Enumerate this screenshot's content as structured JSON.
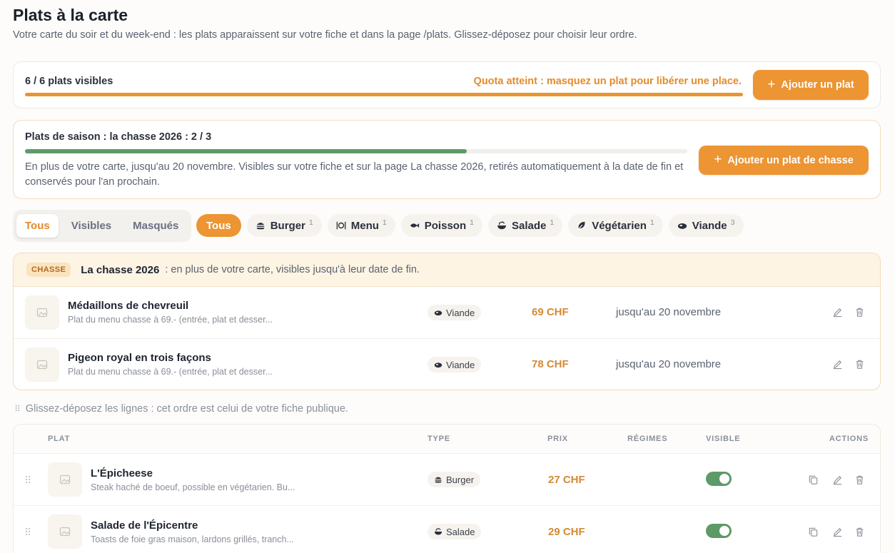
{
  "header": {
    "title": "Plats à la carte",
    "subtitle": "Votre carte du soir et du week-end : les plats apparaissent sur votre fiche et dans la page /plats. Glissez-déposez pour choisir leur ordre."
  },
  "quota": {
    "count_label": "6 / 6 plats visibles",
    "used": 6,
    "max": 6,
    "warning": "Quota atteint : masquez un plat pour libérer une place.",
    "add_button": "Ajouter un plat"
  },
  "season": {
    "title": "Plats de saison : la chasse 2026 : 2 / 3",
    "used": 2,
    "max": 3,
    "description": "En plus de votre carte, jusqu'au 20 novembre. Visibles sur votre fiche et sur la page La chasse 2026, retirés automatiquement à la date de fin et conservés pour l'an prochain.",
    "add_button": "Ajouter un plat de chasse"
  },
  "visibility_filter": {
    "options": [
      "Tous",
      "Visibles",
      "Masqués"
    ],
    "selected": "Tous"
  },
  "category_chips": [
    {
      "label": "Tous",
      "count": "",
      "icon": "",
      "active": true
    },
    {
      "label": "Burger",
      "count": "1",
      "icon": "burger-icon",
      "active": false
    },
    {
      "label": "Menu",
      "count": "1",
      "icon": "plate-cutlery-icon",
      "active": false
    },
    {
      "label": "Poisson",
      "count": "1",
      "icon": "fish-icon",
      "active": false
    },
    {
      "label": "Salade",
      "count": "1",
      "icon": "salad-icon",
      "active": false
    },
    {
      "label": "Végétarien",
      "count": "1",
      "icon": "leaf-icon",
      "active": false
    },
    {
      "label": "Viande",
      "count": "3",
      "icon": "meat-icon",
      "active": false
    }
  ],
  "hunt_section": {
    "badge": "CHASSE",
    "name": "La chasse 2026",
    "note": ": en plus de votre carte, visibles jusqu'à leur date de fin.",
    "rows": [
      {
        "name": "Médaillons de chevreuil",
        "description": "Plat du menu chasse à 69.- (entrée, plat et desser...",
        "type": "Viande",
        "price": "69 CHF",
        "until": "jusqu'au 20 novembre"
      },
      {
        "name": "Pigeon royal en trois façons",
        "description": "Plat du menu chasse à 69.- (entrée, plat et desser...",
        "type": "Viande",
        "price": "78 CHF",
        "until": "jusqu'au 20 novembre"
      }
    ]
  },
  "drag_hint": "Glissez-déposez les lignes : cet ordre est celui de votre fiche publique.",
  "table": {
    "headers": {
      "plat": "PLAT",
      "type": "TYPE",
      "prix": "PRIX",
      "regimes": "RÉGIMES",
      "visible": "VISIBLE",
      "actions": "ACTIONS"
    },
    "rows": [
      {
        "name": "L'Épicheese",
        "description": "Steak haché de boeuf, possible en végétarien. Bu...",
        "type": "Burger",
        "price": "27 CHF",
        "visible": true
      },
      {
        "name": "Salade de l'Épicentre",
        "description": "Toasts de foie gras maison, lardons grillés, tranch...",
        "type": "Salade",
        "price": "29 CHF",
        "visible": true
      }
    ]
  },
  "colors": {
    "accent": "#ec9532",
    "success": "#5d9a67",
    "warning_text": "#e38b2d"
  }
}
